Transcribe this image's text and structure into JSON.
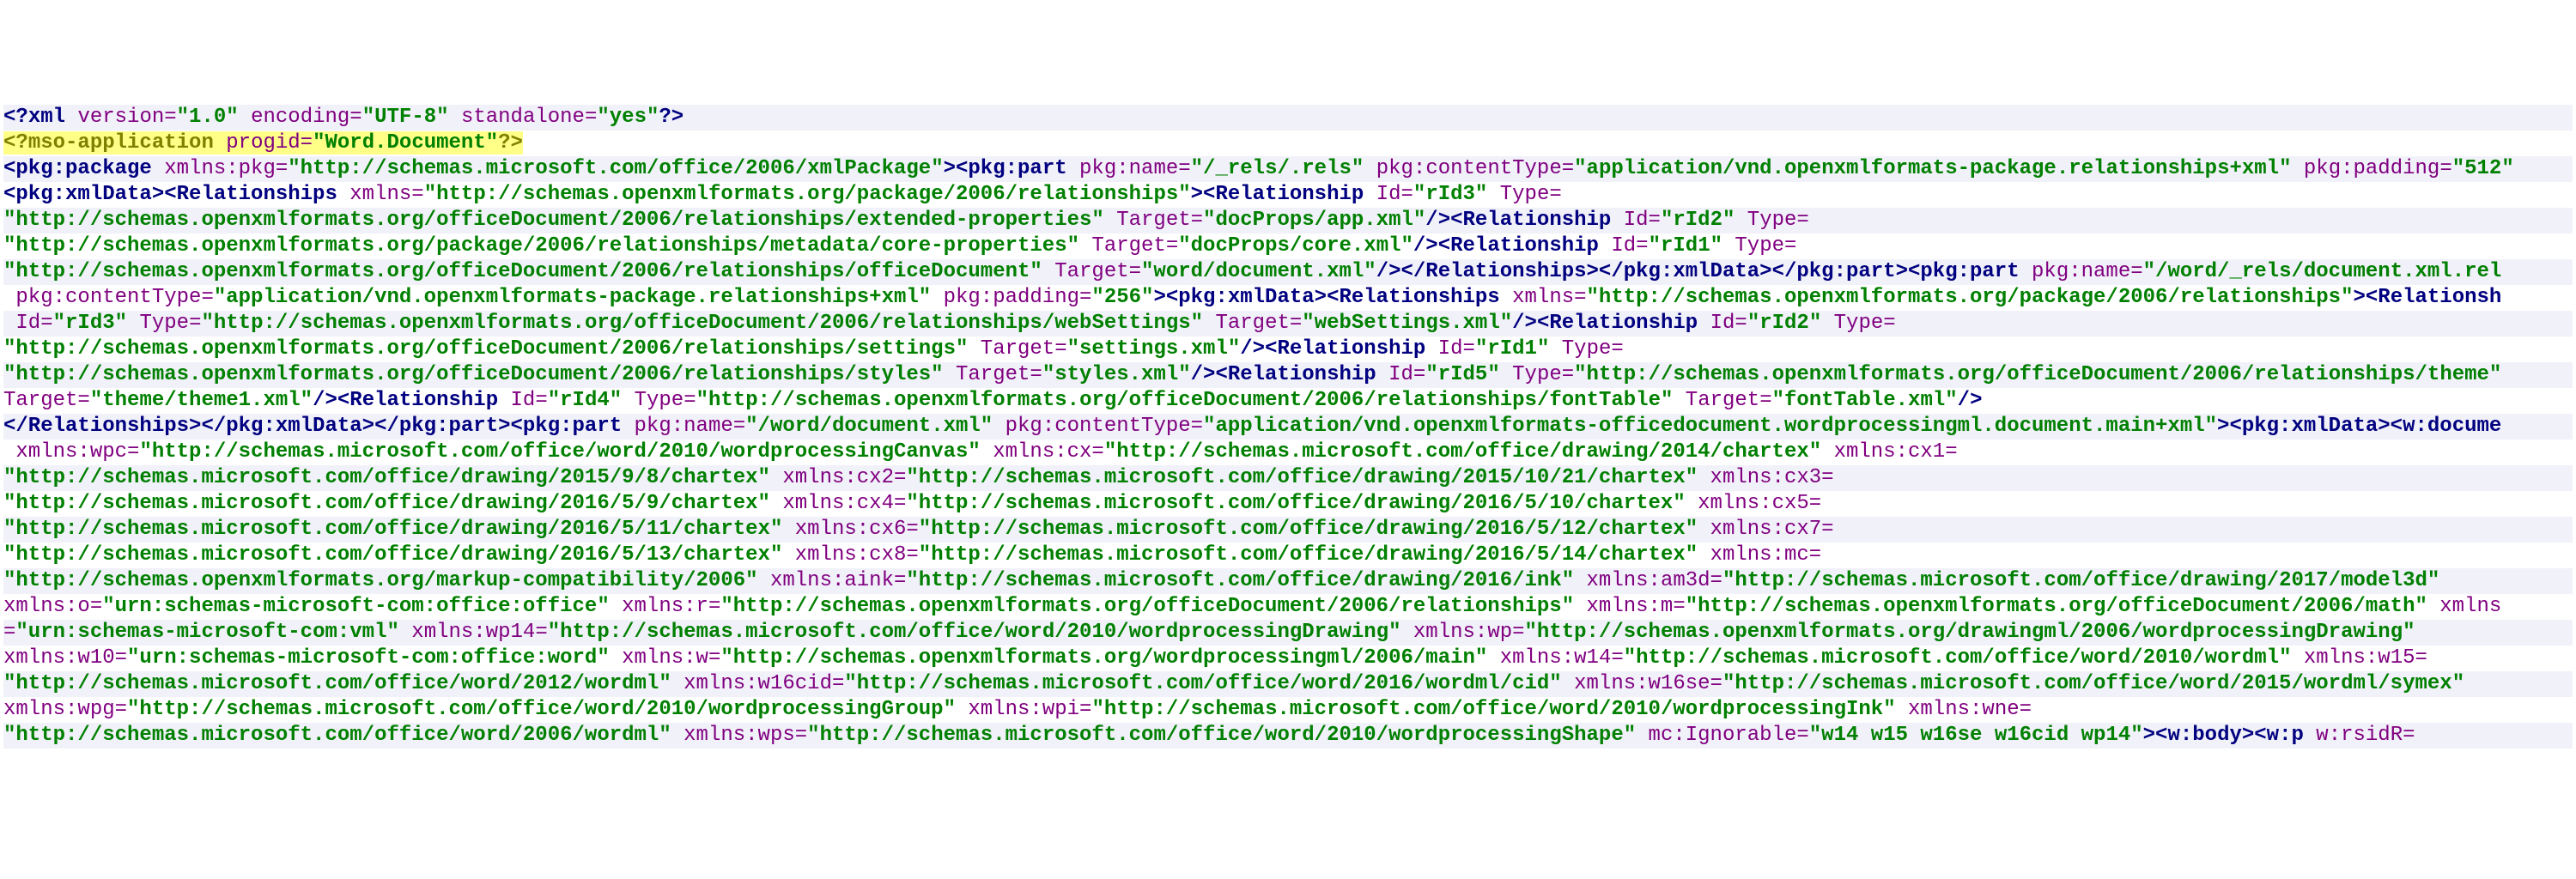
{
  "xml_declaration": {
    "tag": "xml",
    "attrs": [
      {
        "name": "version",
        "value": "\"1.0\""
      },
      {
        "name": "encoding",
        "value": "\"UTF-8\""
      },
      {
        "name": "standalone",
        "value": "\"yes\""
      }
    ]
  },
  "mso_pi": {
    "tag": "mso-application",
    "attrs": [
      {
        "name": "progid",
        "value": "\"Word.Document\""
      }
    ]
  },
  "lines": [
    [
      {
        "k": "tag",
        "t": "<pkg:package"
      },
      {
        "k": "sp"
      },
      {
        "k": "attr",
        "t": "xmlns:pkg="
      },
      {
        "k": "val",
        "t": "\"http://schemas.microsoft.com/office/2006/xmlPackage\""
      },
      {
        "k": "tag",
        "t": "><pkg:part"
      },
      {
        "k": "sp"
      },
      {
        "k": "attr",
        "t": "pkg:name="
      },
      {
        "k": "val",
        "t": "\"/_rels/.rels\""
      },
      {
        "k": "sp"
      },
      {
        "k": "attr",
        "t": "pkg:contentType="
      },
      {
        "k": "val",
        "t": "\"application/vnd.openxmlformats-package.relationships+xml\""
      },
      {
        "k": "sp"
      },
      {
        "k": "attr",
        "t": "pkg:padding="
      },
      {
        "k": "val",
        "t": "\"512\""
      }
    ],
    [
      {
        "k": "tag",
        "t": "<pkg:xmlData><Relationships"
      },
      {
        "k": "sp"
      },
      {
        "k": "attr",
        "t": "xmlns="
      },
      {
        "k": "val",
        "t": "\"http://schemas.openxmlformats.org/package/2006/relationships\""
      },
      {
        "k": "tag",
        "t": "><Relationship"
      },
      {
        "k": "sp"
      },
      {
        "k": "attr",
        "t": "Id="
      },
      {
        "k": "val",
        "t": "\"rId3\""
      },
      {
        "k": "sp"
      },
      {
        "k": "attr",
        "t": "Type="
      }
    ],
    [
      {
        "k": "val",
        "t": "\"http://schemas.openxmlformats.org/officeDocument/2006/relationships/extended-properties\""
      },
      {
        "k": "sp"
      },
      {
        "k": "attr",
        "t": "Target="
      },
      {
        "k": "val",
        "t": "\"docProps/app.xml\""
      },
      {
        "k": "tag",
        "t": "/><Relationship"
      },
      {
        "k": "sp"
      },
      {
        "k": "attr",
        "t": "Id="
      },
      {
        "k": "val",
        "t": "\"rId2\""
      },
      {
        "k": "sp"
      },
      {
        "k": "attr",
        "t": "Type="
      }
    ],
    [
      {
        "k": "val",
        "t": "\"http://schemas.openxmlformats.org/package/2006/relationships/metadata/core-properties\""
      },
      {
        "k": "sp"
      },
      {
        "k": "attr",
        "t": "Target="
      },
      {
        "k": "val",
        "t": "\"docProps/core.xml\""
      },
      {
        "k": "tag",
        "t": "/><Relationship"
      },
      {
        "k": "sp"
      },
      {
        "k": "attr",
        "t": "Id="
      },
      {
        "k": "val",
        "t": "\"rId1\""
      },
      {
        "k": "sp"
      },
      {
        "k": "attr",
        "t": "Type="
      }
    ],
    [
      {
        "k": "val",
        "t": "\"http://schemas.openxmlformats.org/officeDocument/2006/relationships/officeDocument\""
      },
      {
        "k": "sp"
      },
      {
        "k": "attr",
        "t": "Target="
      },
      {
        "k": "val",
        "t": "\"word/document.xml\""
      },
      {
        "k": "tag",
        "t": "/></Relationships></pkg:xmlData></pkg:part><pkg:part"
      },
      {
        "k": "sp"
      },
      {
        "k": "attr",
        "t": "pkg:name="
      },
      {
        "k": "val",
        "t": "\"/word/_rels/document.xml.rel"
      }
    ],
    [
      {
        "k": "sp"
      },
      {
        "k": "attr",
        "t": "pkg:contentType="
      },
      {
        "k": "val",
        "t": "\"application/vnd.openxmlformats-package.relationships+xml\""
      },
      {
        "k": "sp"
      },
      {
        "k": "attr",
        "t": "pkg:padding="
      },
      {
        "k": "val",
        "t": "\"256\""
      },
      {
        "k": "tag",
        "t": "><pkg:xmlData><Relationships"
      },
      {
        "k": "sp"
      },
      {
        "k": "attr",
        "t": "xmlns="
      },
      {
        "k": "val",
        "t": "\"http://schemas.openxmlformats.org/package/2006/relationships\""
      },
      {
        "k": "tag",
        "t": "><Relationsh"
      }
    ],
    [
      {
        "k": "sp"
      },
      {
        "k": "attr",
        "t": "Id="
      },
      {
        "k": "val",
        "t": "\"rId3\""
      },
      {
        "k": "sp"
      },
      {
        "k": "attr",
        "t": "Type="
      },
      {
        "k": "val",
        "t": "\"http://schemas.openxmlformats.org/officeDocument/2006/relationships/webSettings\""
      },
      {
        "k": "sp"
      },
      {
        "k": "attr",
        "t": "Target="
      },
      {
        "k": "val",
        "t": "\"webSettings.xml\""
      },
      {
        "k": "tag",
        "t": "/><Relationship"
      },
      {
        "k": "sp"
      },
      {
        "k": "attr",
        "t": "Id="
      },
      {
        "k": "val",
        "t": "\"rId2\""
      },
      {
        "k": "sp"
      },
      {
        "k": "attr",
        "t": "Type="
      }
    ],
    [
      {
        "k": "val",
        "t": "\"http://schemas.openxmlformats.org/officeDocument/2006/relationships/settings\""
      },
      {
        "k": "sp"
      },
      {
        "k": "attr",
        "t": "Target="
      },
      {
        "k": "val",
        "t": "\"settings.xml\""
      },
      {
        "k": "tag",
        "t": "/><Relationship"
      },
      {
        "k": "sp"
      },
      {
        "k": "attr",
        "t": "Id="
      },
      {
        "k": "val",
        "t": "\"rId1\""
      },
      {
        "k": "sp"
      },
      {
        "k": "attr",
        "t": "Type="
      }
    ],
    [
      {
        "k": "val",
        "t": "\"http://schemas.openxmlformats.org/officeDocument/2006/relationships/styles\""
      },
      {
        "k": "sp"
      },
      {
        "k": "attr",
        "t": "Target="
      },
      {
        "k": "val",
        "t": "\"styles.xml\""
      },
      {
        "k": "tag",
        "t": "/><Relationship"
      },
      {
        "k": "sp"
      },
      {
        "k": "attr",
        "t": "Id="
      },
      {
        "k": "val",
        "t": "\"rId5\""
      },
      {
        "k": "sp"
      },
      {
        "k": "attr",
        "t": "Type="
      },
      {
        "k": "val",
        "t": "\"http://schemas.openxmlformats.org/officeDocument/2006/relationships/theme\""
      }
    ],
    [
      {
        "k": "attr",
        "t": "Target="
      },
      {
        "k": "val",
        "t": "\"theme/theme1.xml\""
      },
      {
        "k": "tag",
        "t": "/><Relationship"
      },
      {
        "k": "sp"
      },
      {
        "k": "attr",
        "t": "Id="
      },
      {
        "k": "val",
        "t": "\"rId4\""
      },
      {
        "k": "sp"
      },
      {
        "k": "attr",
        "t": "Type="
      },
      {
        "k": "val",
        "t": "\"http://schemas.openxmlformats.org/officeDocument/2006/relationships/fontTable\""
      },
      {
        "k": "sp"
      },
      {
        "k": "attr",
        "t": "Target="
      },
      {
        "k": "val",
        "t": "\"fontTable.xml\""
      },
      {
        "k": "tag",
        "t": "/>"
      }
    ],
    [
      {
        "k": "tag",
        "t": "</Relationships></pkg:xmlData></pkg:part><pkg:part"
      },
      {
        "k": "sp"
      },
      {
        "k": "attr",
        "t": "pkg:name="
      },
      {
        "k": "val",
        "t": "\"/word/document.xml\""
      },
      {
        "k": "sp"
      },
      {
        "k": "attr",
        "t": "pkg:contentType="
      },
      {
        "k": "val",
        "t": "\"application/vnd.openxmlformats-officedocument.wordprocessingml.document.main+xml\""
      },
      {
        "k": "tag",
        "t": "><pkg:xmlData><w:docume"
      }
    ],
    [
      {
        "k": "sp"
      },
      {
        "k": "attr",
        "t": "xmlns:wpc="
      },
      {
        "k": "val",
        "t": "\"http://schemas.microsoft.com/office/word/2010/wordprocessingCanvas\""
      },
      {
        "k": "sp"
      },
      {
        "k": "attr",
        "t": "xmlns:cx="
      },
      {
        "k": "val",
        "t": "\"http://schemas.microsoft.com/office/drawing/2014/chartex\""
      },
      {
        "k": "sp"
      },
      {
        "k": "attr",
        "t": "xmlns:cx1="
      }
    ],
    [
      {
        "k": "val",
        "t": "\"http://schemas.microsoft.com/office/drawing/2015/9/8/chartex\""
      },
      {
        "k": "sp"
      },
      {
        "k": "attr",
        "t": "xmlns:cx2="
      },
      {
        "k": "val",
        "t": "\"http://schemas.microsoft.com/office/drawing/2015/10/21/chartex\""
      },
      {
        "k": "sp"
      },
      {
        "k": "attr",
        "t": "xmlns:cx3="
      }
    ],
    [
      {
        "k": "val",
        "t": "\"http://schemas.microsoft.com/office/drawing/2016/5/9/chartex\""
      },
      {
        "k": "sp"
      },
      {
        "k": "attr",
        "t": "xmlns:cx4="
      },
      {
        "k": "val",
        "t": "\"http://schemas.microsoft.com/office/drawing/2016/5/10/chartex\""
      },
      {
        "k": "sp"
      },
      {
        "k": "attr",
        "t": "xmlns:cx5="
      }
    ],
    [
      {
        "k": "val",
        "t": "\"http://schemas.microsoft.com/office/drawing/2016/5/11/chartex\""
      },
      {
        "k": "sp"
      },
      {
        "k": "attr",
        "t": "xmlns:cx6="
      },
      {
        "k": "val",
        "t": "\"http://schemas.microsoft.com/office/drawing/2016/5/12/chartex\""
      },
      {
        "k": "sp"
      },
      {
        "k": "attr",
        "t": "xmlns:cx7="
      }
    ],
    [
      {
        "k": "val",
        "t": "\"http://schemas.microsoft.com/office/drawing/2016/5/13/chartex\""
      },
      {
        "k": "sp"
      },
      {
        "k": "attr",
        "t": "xmlns:cx8="
      },
      {
        "k": "val",
        "t": "\"http://schemas.microsoft.com/office/drawing/2016/5/14/chartex\""
      },
      {
        "k": "sp"
      },
      {
        "k": "attr",
        "t": "xmlns:mc="
      }
    ],
    [
      {
        "k": "val",
        "t": "\"http://schemas.openxmlformats.org/markup-compatibility/2006\""
      },
      {
        "k": "sp"
      },
      {
        "k": "attr",
        "t": "xmlns:aink="
      },
      {
        "k": "val",
        "t": "\"http://schemas.microsoft.com/office/drawing/2016/ink\""
      },
      {
        "k": "sp"
      },
      {
        "k": "attr",
        "t": "xmlns:am3d="
      },
      {
        "k": "val",
        "t": "\"http://schemas.microsoft.com/office/drawing/2017/model3d\""
      }
    ],
    [
      {
        "k": "attr",
        "t": "xmlns:o="
      },
      {
        "k": "val",
        "t": "\"urn:schemas-microsoft-com:office:office\""
      },
      {
        "k": "sp"
      },
      {
        "k": "attr",
        "t": "xmlns:r="
      },
      {
        "k": "val",
        "t": "\"http://schemas.openxmlformats.org/officeDocument/2006/relationships\""
      },
      {
        "k": "sp"
      },
      {
        "k": "attr",
        "t": "xmlns:m="
      },
      {
        "k": "val",
        "t": "\"http://schemas.openxmlformats.org/officeDocument/2006/math\""
      },
      {
        "k": "sp"
      },
      {
        "k": "attr",
        "t": "xmlns"
      }
    ],
    [
      {
        "k": "attr",
        "t": "="
      },
      {
        "k": "val",
        "t": "\"urn:schemas-microsoft-com:vml\""
      },
      {
        "k": "sp"
      },
      {
        "k": "attr",
        "t": "xmlns:wp14="
      },
      {
        "k": "val",
        "t": "\"http://schemas.microsoft.com/office/word/2010/wordprocessingDrawing\""
      },
      {
        "k": "sp"
      },
      {
        "k": "attr",
        "t": "xmlns:wp="
      },
      {
        "k": "val",
        "t": "\"http://schemas.openxmlformats.org/drawingml/2006/wordprocessingDrawing\""
      }
    ],
    [
      {
        "k": "attr",
        "t": "xmlns:w10="
      },
      {
        "k": "val",
        "t": "\"urn:schemas-microsoft-com:office:word\""
      },
      {
        "k": "sp"
      },
      {
        "k": "attr",
        "t": "xmlns:w="
      },
      {
        "k": "val",
        "t": "\"http://schemas.openxmlformats.org/wordprocessingml/2006/main\""
      },
      {
        "k": "sp"
      },
      {
        "k": "attr",
        "t": "xmlns:w14="
      },
      {
        "k": "val",
        "t": "\"http://schemas.microsoft.com/office/word/2010/wordml\""
      },
      {
        "k": "sp"
      },
      {
        "k": "attr",
        "t": "xmlns:w15="
      }
    ],
    [
      {
        "k": "val",
        "t": "\"http://schemas.microsoft.com/office/word/2012/wordml\""
      },
      {
        "k": "sp"
      },
      {
        "k": "attr",
        "t": "xmlns:w16cid="
      },
      {
        "k": "val",
        "t": "\"http://schemas.microsoft.com/office/word/2016/wordml/cid\""
      },
      {
        "k": "sp"
      },
      {
        "k": "attr",
        "t": "xmlns:w16se="
      },
      {
        "k": "val",
        "t": "\"http://schemas.microsoft.com/office/word/2015/wordml/symex\""
      }
    ],
    [
      {
        "k": "attr",
        "t": "xmlns:wpg="
      },
      {
        "k": "val",
        "t": "\"http://schemas.microsoft.com/office/word/2010/wordprocessingGroup\""
      },
      {
        "k": "sp"
      },
      {
        "k": "attr",
        "t": "xmlns:wpi="
      },
      {
        "k": "val",
        "t": "\"http://schemas.microsoft.com/office/word/2010/wordprocessingInk\""
      },
      {
        "k": "sp"
      },
      {
        "k": "attr",
        "t": "xmlns:wne="
      }
    ],
    [
      {
        "k": "val",
        "t": "\"http://schemas.microsoft.com/office/word/2006/wordml\""
      },
      {
        "k": "sp"
      },
      {
        "k": "attr",
        "t": "xmlns:wps="
      },
      {
        "k": "val",
        "t": "\"http://schemas.microsoft.com/office/word/2010/wordprocessingShape\""
      },
      {
        "k": "sp"
      },
      {
        "k": "attr",
        "t": "mc:Ignorable="
      },
      {
        "k": "val",
        "t": "\"w14 w15 w16se w16cid wp14\""
      },
      {
        "k": "tag",
        "t": "><w:body><w:p"
      },
      {
        "k": "sp"
      },
      {
        "k": "attr",
        "t": "w:rsidR="
      }
    ]
  ]
}
